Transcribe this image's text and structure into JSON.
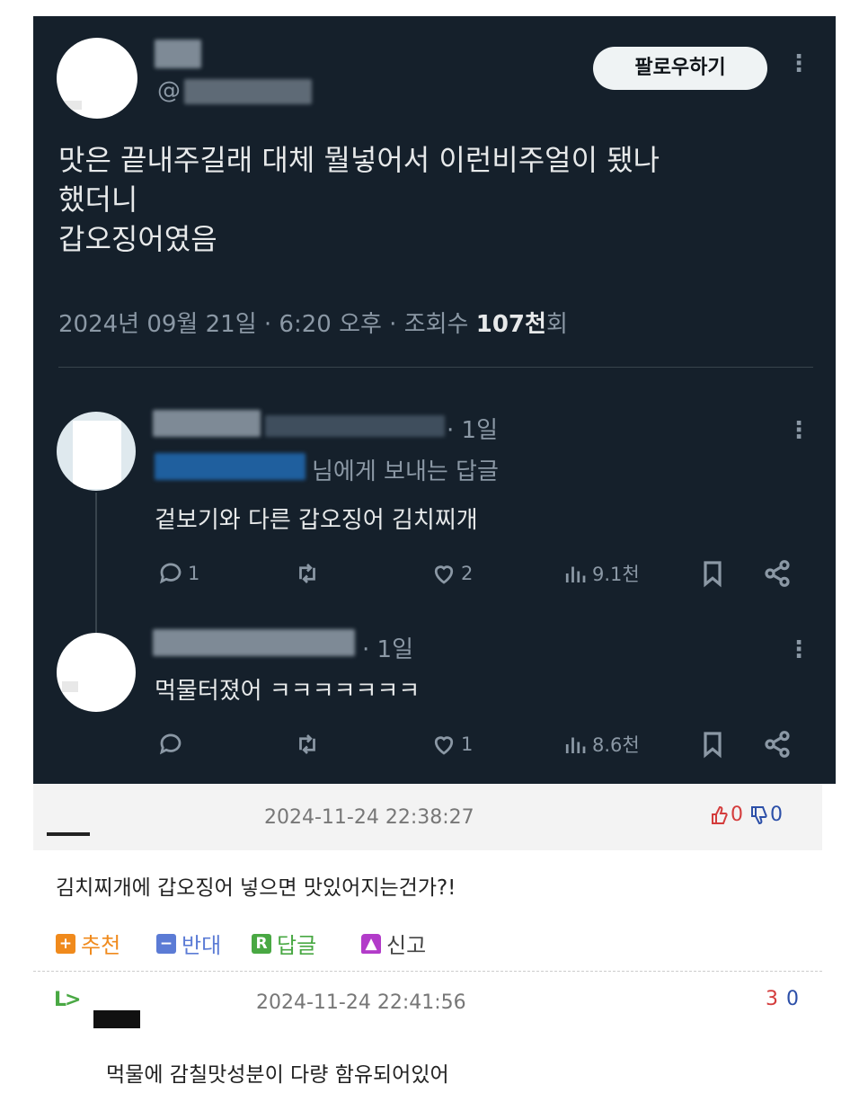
{
  "tweet": {
    "handle_prefix": "@",
    "follow_label": "팔로우하기",
    "text": "맛은 끝내주길래 대체 뭘넣어서 이런비주얼이 됐나\n했더니\n갑오징어였음",
    "meta_before": "2024년 09월 21일 · 6:20 오후 · 조회수 ",
    "meta_views": "107천",
    "meta_after": "회"
  },
  "replies": [
    {
      "time": "· 1일",
      "reply_to_suffix": "님에게 보내는 답글",
      "text": "겉보기와 다른 갑오징어 김치찌개",
      "stats": {
        "replies": "1",
        "retweets": "",
        "likes": "2",
        "views": "9.1천"
      }
    },
    {
      "time": "· 1일",
      "text": "먹물터졌어 ㅋㅋㅋㅋㅋㅋㅋ",
      "stats": {
        "replies": "",
        "retweets": "",
        "likes": "1",
        "views": "8.6천"
      }
    }
  ],
  "comments": [
    {
      "date": "2024-11-24 22:38:27",
      "up": "0",
      "down": "0",
      "body": "김치찌개에 갑오징어 넣으면 맛있어지는건가?!",
      "buttons": {
        "recommend": "추천",
        "oppose": "반대",
        "reply": "답글",
        "report": "신고"
      }
    },
    {
      "reply_arrow": "L>",
      "date": "2024-11-24 22:41:56",
      "up": "3",
      "down": "0",
      "body": "먹물에 감칠맛성분이 다량 함유되어있어"
    }
  ],
  "colors": {
    "panel_bg": "#15202b",
    "text_primary": "#e7e9ea",
    "text_secondary": "#8b98a5",
    "up_vote": "#d43c3c",
    "down_vote": "#2c4fa8",
    "recommend_orange": "#f08a1c",
    "oppose_blue": "#5b7bd5",
    "reply_green": "#49a843",
    "report_purple": "#b23bc9"
  }
}
